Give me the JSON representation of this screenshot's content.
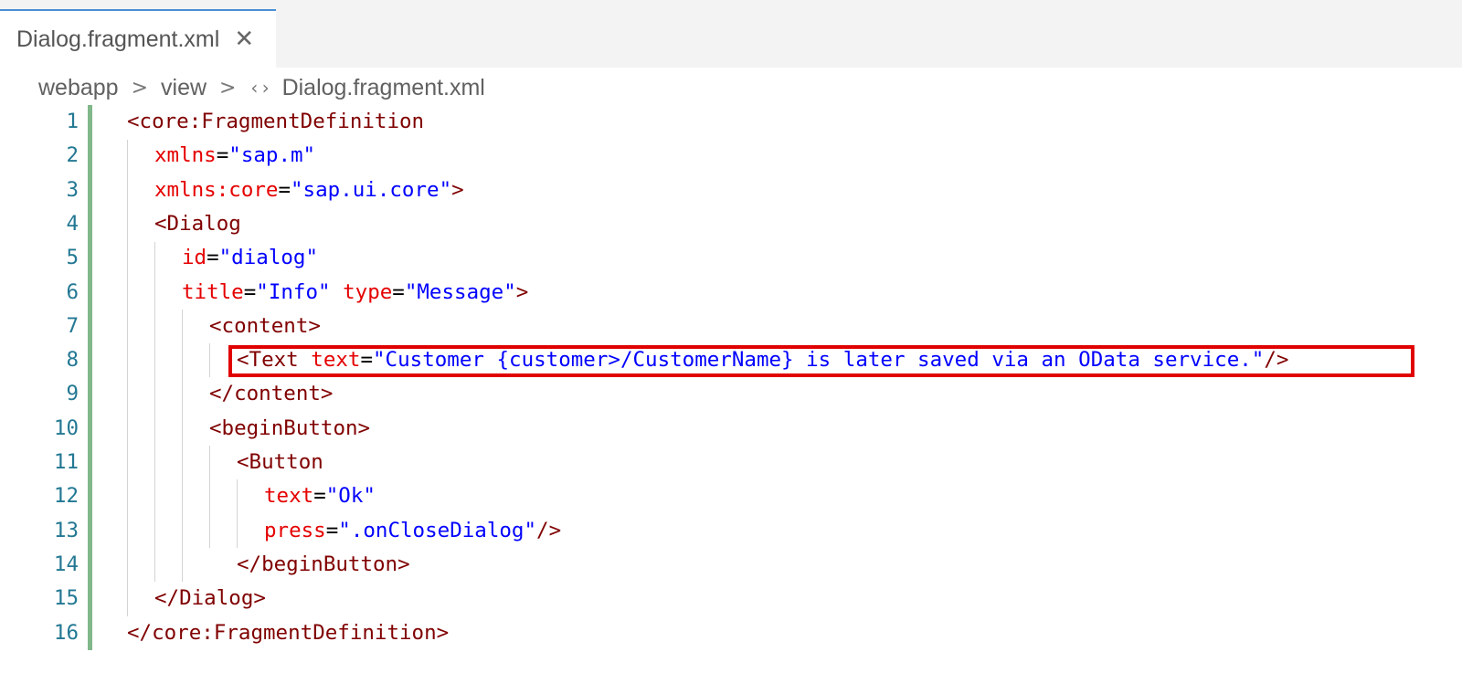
{
  "tab": {
    "label": "Dialog.fragment.xml",
    "close_icon": "close-icon"
  },
  "breadcrumb": {
    "items": [
      "webapp",
      "view",
      "Dialog.fragment.xml"
    ],
    "separator_icon": "chevron-right-icon",
    "file_icon": "code-file-icon"
  },
  "code": {
    "lines": [
      {
        "num": "1",
        "tokens": [
          [
            "t",
            "<core:FragmentDefinition"
          ]
        ]
      },
      {
        "num": "2",
        "tokens": [
          [
            "a",
            "xmlns"
          ],
          [
            "p",
            "="
          ],
          [
            "s",
            "\"sap.m\""
          ]
        ]
      },
      {
        "num": "3",
        "tokens": [
          [
            "a",
            "xmlns:core"
          ],
          [
            "p",
            "="
          ],
          [
            "s",
            "\"sap.ui.core\""
          ],
          [
            "t",
            ">"
          ]
        ]
      },
      {
        "num": "4",
        "tokens": [
          [
            "t",
            "<Dialog"
          ]
        ]
      },
      {
        "num": "5",
        "tokens": [
          [
            "a",
            "id"
          ],
          [
            "p",
            "="
          ],
          [
            "s",
            "\"dialog\""
          ]
        ]
      },
      {
        "num": "6",
        "tokens": [
          [
            "a",
            "title"
          ],
          [
            "p",
            "="
          ],
          [
            "s",
            "\"Info\""
          ],
          [
            "p",
            " "
          ],
          [
            "a",
            "type"
          ],
          [
            "p",
            "="
          ],
          [
            "s",
            "\"Message\""
          ],
          [
            "t",
            ">"
          ]
        ]
      },
      {
        "num": "7",
        "tokens": [
          [
            "t",
            "<content>"
          ]
        ]
      },
      {
        "num": "8",
        "tokens": [
          [
            "t",
            "<Text"
          ],
          [
            "p",
            " "
          ],
          [
            "a",
            "text"
          ],
          [
            "p",
            "="
          ],
          [
            "s",
            "\"Customer {customer>/CustomerName} is later saved via an OData service.\""
          ],
          [
            "t",
            "/>"
          ]
        ]
      },
      {
        "num": "9",
        "tokens": [
          [
            "t",
            "</content>"
          ]
        ]
      },
      {
        "num": "10",
        "tokens": [
          [
            "t",
            "<beginButton>"
          ]
        ]
      },
      {
        "num": "11",
        "tokens": [
          [
            "t",
            "<Button"
          ]
        ]
      },
      {
        "num": "12",
        "tokens": [
          [
            "a",
            "text"
          ],
          [
            "p",
            "="
          ],
          [
            "s",
            "\"Ok\""
          ]
        ]
      },
      {
        "num": "13",
        "tokens": [
          [
            "a",
            "press"
          ],
          [
            "p",
            "="
          ],
          [
            "s",
            "\".onCloseDialog\""
          ],
          [
            "t",
            "/>"
          ]
        ]
      },
      {
        "num": "14",
        "tokens": [
          [
            "t",
            "</beginButton>"
          ]
        ]
      },
      {
        "num": "15",
        "tokens": [
          [
            "t",
            "</Dialog>"
          ]
        ]
      },
      {
        "num": "16",
        "tokens": [
          [
            "t",
            "</core:FragmentDefinition>"
          ]
        ]
      }
    ]
  },
  "colors": {
    "tag": "#800000",
    "attribute": "#e50000",
    "string": "#0000ff",
    "line_number": "#237893",
    "gutter_modified": "#81b88b",
    "highlight_box": "#e00000"
  }
}
